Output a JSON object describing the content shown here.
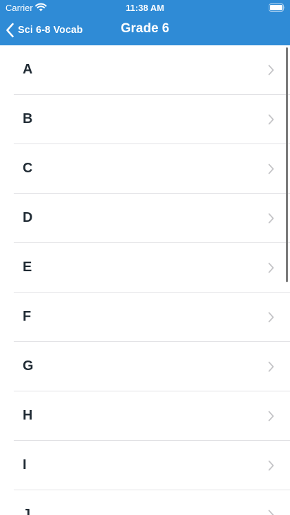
{
  "status_bar": {
    "carrier": "Carrier",
    "time": "11:38 AM"
  },
  "nav": {
    "back_label": "Sci 6-8 Vocab",
    "title": "Grade 6"
  },
  "colors": {
    "header_bg": "#2f8bd6",
    "row_text": "#1f2a33",
    "separator": "#e1e1e4",
    "chevron": "#c4c4c7"
  },
  "list": {
    "items": [
      {
        "label": "A"
      },
      {
        "label": "B"
      },
      {
        "label": "C"
      },
      {
        "label": "D"
      },
      {
        "label": "E"
      },
      {
        "label": "F"
      },
      {
        "label": "G"
      },
      {
        "label": "H"
      },
      {
        "label": "I"
      },
      {
        "label": "J"
      }
    ]
  }
}
